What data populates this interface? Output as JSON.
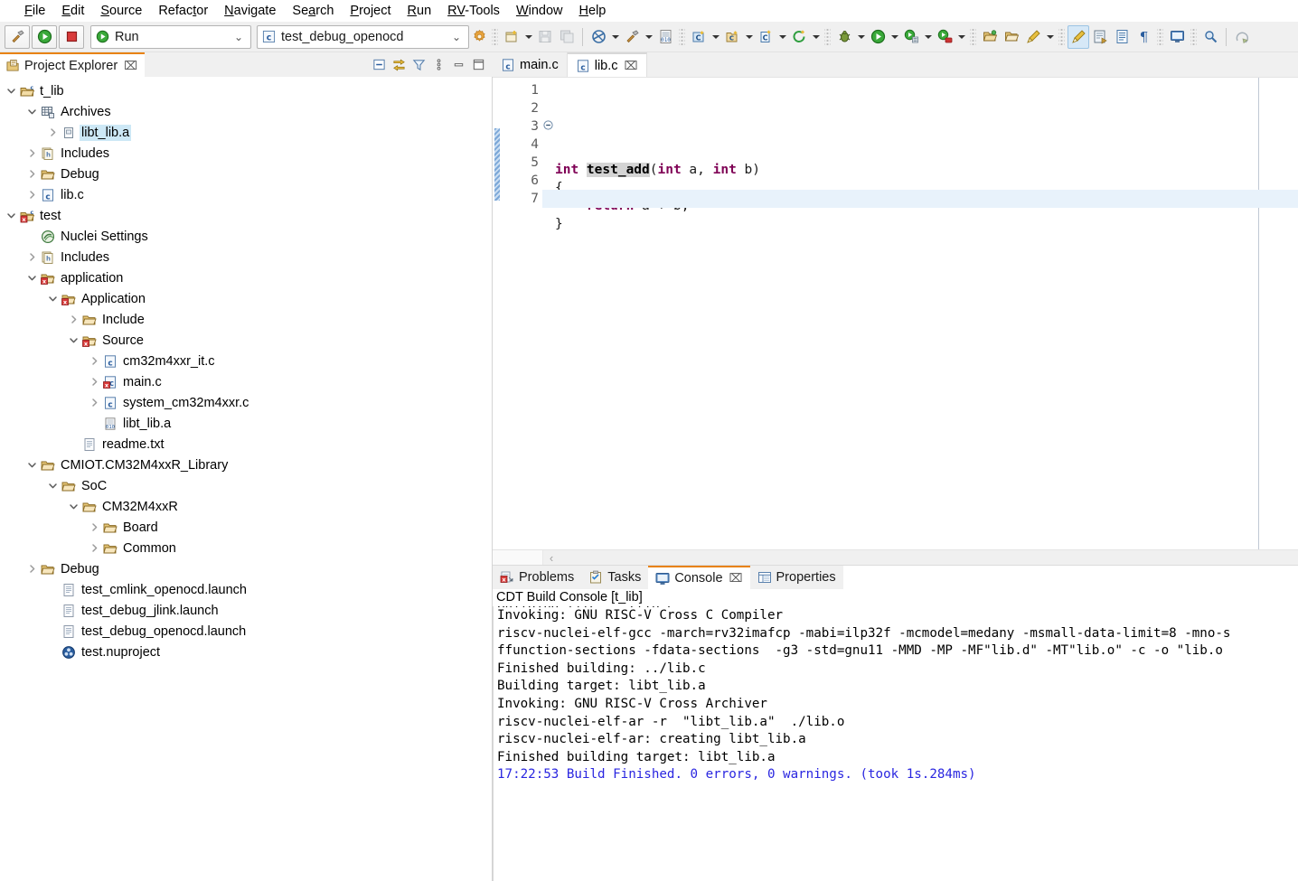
{
  "menubar": {
    "items": [
      {
        "label": "File",
        "mnemonic": "F"
      },
      {
        "label": "Edit",
        "mnemonic": "E"
      },
      {
        "label": "Source",
        "mnemonic": "S"
      },
      {
        "label": "Refactor",
        "mnemonic": "t"
      },
      {
        "label": "Navigate",
        "mnemonic": "N"
      },
      {
        "label": "Search",
        "mnemonic": "a"
      },
      {
        "label": "Project",
        "mnemonic": "P"
      },
      {
        "label": "Run",
        "mnemonic": "R"
      },
      {
        "label": "RV-Tools",
        "mnemonic": "RV"
      },
      {
        "label": "Window",
        "mnemonic": "W"
      },
      {
        "label": "Help",
        "mnemonic": "H"
      }
    ]
  },
  "toolbar": {
    "build_icon": "hammer-icon",
    "run_icon": "run-green-play-icon",
    "stop_icon": "stop-red-square-icon",
    "run_combo": {
      "value": "Run",
      "icon": "run-green-play-icon"
    },
    "config_combo": {
      "value": "test_debug_openocd",
      "icon": "c-file-icon"
    },
    "gear_icon": "gear-icon",
    "right_icons": [
      "new-file-icon",
      "save-icon",
      "save-all-icon",
      "build-all-icon",
      "build-hammer-icon",
      "binary-010-icon",
      "new-c-project-icon",
      "new-c-folder-icon",
      "new-c-file-icon",
      "new-class-icon",
      "debug-bug-icon",
      "run-icon",
      "run-external-tools-icon",
      "run-last-tool-icon",
      "open-folder-icon",
      "open-folder-2-icon",
      "paintbrush-icon",
      "pencil-icon",
      "export-icon",
      "index-icon",
      "pilcrow-icon",
      "console-icon",
      "search-magnifier-icon",
      "skip-icon"
    ]
  },
  "project_explorer": {
    "title": "Project Explorer",
    "close_glyph": "⌧",
    "toolbar_icons": [
      "collapse-all-icon",
      "link-with-editor-icon",
      "filter-icon",
      "view-menu-icon",
      "minimize-icon",
      "maximize-icon"
    ],
    "tree": [
      {
        "label": "t_lib",
        "depth": 0,
        "twist": "open",
        "icon": "c-project-icon",
        "selected": false
      },
      {
        "label": "Archives",
        "depth": 1,
        "twist": "open",
        "icon": "archives-icon",
        "selected": false
      },
      {
        "label": "libt_lib.a",
        "depth": 2,
        "twist": "closed",
        "icon": "archive-file-icon",
        "selected": true
      },
      {
        "label": "Includes",
        "depth": 1,
        "twist": "closed",
        "icon": "includes-icon",
        "selected": false
      },
      {
        "label": "Debug",
        "depth": 1,
        "twist": "closed",
        "icon": "folder-icon",
        "selected": false
      },
      {
        "label": "lib.c",
        "depth": 1,
        "twist": "closed",
        "icon": "c-file-icon",
        "selected": false
      },
      {
        "label": "test",
        "depth": 0,
        "twist": "open",
        "icon": "c-project-error-icon",
        "selected": false
      },
      {
        "label": "Nuclei Settings",
        "depth": 1,
        "twist": "none",
        "icon": "nuclei-settings-icon",
        "selected": false
      },
      {
        "label": "Includes",
        "depth": 1,
        "twist": "closed",
        "icon": "includes-icon",
        "selected": false
      },
      {
        "label": "application",
        "depth": 1,
        "twist": "open",
        "icon": "src-folder-error-icon",
        "selected": false
      },
      {
        "label": "Application",
        "depth": 2,
        "twist": "open",
        "icon": "src-folder-error-icon",
        "selected": false
      },
      {
        "label": "Include",
        "depth": 3,
        "twist": "closed",
        "icon": "folder-icon",
        "selected": false
      },
      {
        "label": "Source",
        "depth": 3,
        "twist": "open",
        "icon": "src-folder-error-icon",
        "selected": false
      },
      {
        "label": "cm32m4xxr_it.c",
        "depth": 4,
        "twist": "closed",
        "icon": "c-file-icon",
        "selected": false
      },
      {
        "label": "main.c",
        "depth": 4,
        "twist": "closed",
        "icon": "c-file-error-icon",
        "selected": false
      },
      {
        "label": "system_cm32m4xxr.c",
        "depth": 4,
        "twist": "closed",
        "icon": "c-file-icon",
        "selected": false
      },
      {
        "label": "libt_lib.a",
        "depth": 4,
        "twist": "none",
        "icon": "binary-file-icon",
        "selected": false
      },
      {
        "label": "readme.txt",
        "depth": 3,
        "twist": "none",
        "icon": "text-file-icon",
        "selected": false
      },
      {
        "label": "CMIOT.CM32M4xxR_Library",
        "depth": 1,
        "twist": "open",
        "icon": "folder-icon",
        "selected": false
      },
      {
        "label": "SoC",
        "depth": 2,
        "twist": "open",
        "icon": "folder-icon",
        "selected": false
      },
      {
        "label": "CM32M4xxR",
        "depth": 3,
        "twist": "open",
        "icon": "folder-icon",
        "selected": false
      },
      {
        "label": "Board",
        "depth": 4,
        "twist": "closed",
        "icon": "folder-icon",
        "selected": false
      },
      {
        "label": "Common",
        "depth": 4,
        "twist": "closed",
        "icon": "folder-icon",
        "selected": false
      },
      {
        "label": "Debug",
        "depth": 1,
        "twist": "closed",
        "icon": "folder-icon",
        "selected": false
      },
      {
        "label": "test_cmlink_openocd.launch",
        "depth": 2,
        "twist": "none",
        "icon": "launch-file-icon",
        "selected": false
      },
      {
        "label": "test_debug_jlink.launch",
        "depth": 2,
        "twist": "none",
        "icon": "launch-file-icon",
        "selected": false
      },
      {
        "label": "test_debug_openocd.launch",
        "depth": 2,
        "twist": "none",
        "icon": "launch-file-icon",
        "selected": false
      },
      {
        "label": "test.nuproject",
        "depth": 2,
        "twist": "none",
        "icon": "nuproject-icon",
        "selected": false
      }
    ]
  },
  "editor": {
    "tabs": [
      {
        "label": "main.c",
        "icon": "c-file-icon",
        "active": false,
        "closable": false
      },
      {
        "label": "lib.c",
        "icon": "c-file-icon",
        "active": true,
        "closable": true,
        "close_glyph": "⌧"
      }
    ],
    "line_numbers": [
      "1",
      "2",
      "3",
      "4",
      "5",
      "6",
      "7"
    ],
    "fold_marker_line": 3,
    "current_line": 7,
    "code_lines": [
      {
        "n": 1,
        "segments": [
          {
            "t": "",
            "c": "plain"
          }
        ]
      },
      {
        "n": 2,
        "segments": [
          {
            "t": "",
            "c": "plain"
          }
        ]
      },
      {
        "n": 3,
        "segments": [
          {
            "t": "int ",
            "c": "keyword"
          },
          {
            "t": "test_add",
            "c": "funcname"
          },
          {
            "t": "(",
            "c": "plain"
          },
          {
            "t": "int",
            "c": "keyword"
          },
          {
            "t": " a, ",
            "c": "plain"
          },
          {
            "t": "int",
            "c": "keyword"
          },
          {
            "t": " b)",
            "c": "plain"
          }
        ]
      },
      {
        "n": 4,
        "segments": [
          {
            "t": "{",
            "c": "plain"
          }
        ]
      },
      {
        "n": 5,
        "segments": [
          {
            "t": "    ",
            "c": "plain"
          },
          {
            "t": "return",
            "c": "keyword"
          },
          {
            "t": " a + b;",
            "c": "plain"
          }
        ]
      },
      {
        "n": 6,
        "segments": [
          {
            "t": "}",
            "c": "plain"
          }
        ]
      },
      {
        "n": 7,
        "segments": [
          {
            "t": "",
            "c": "plain"
          }
        ]
      }
    ],
    "scroll_left_arrow": "‹"
  },
  "bottom_panel": {
    "tabs": [
      {
        "label": "Problems",
        "icon": "problems-icon",
        "active": false,
        "closable": false
      },
      {
        "label": "Tasks",
        "icon": "tasks-icon",
        "active": false,
        "closable": false
      },
      {
        "label": "Console",
        "icon": "console-icon",
        "active": true,
        "closable": true,
        "close_glyph": "⌧"
      },
      {
        "label": "Properties",
        "icon": "properties-icon",
        "active": false,
        "closable": false
      }
    ],
    "console_title": "CDT Build Console [t_lib]",
    "console_lines": [
      {
        "text": "Building file: ../lib.c",
        "color": "black",
        "clipped_top": true
      },
      {
        "text": "Invoking: GNU RISC-V Cross C Compiler",
        "color": "black"
      },
      {
        "text": "riscv-nuclei-elf-gcc -march=rv32imafcp -mabi=ilp32f -mcmodel=medany -msmall-data-limit=8 -mno-s",
        "color": "black"
      },
      {
        "text": "ffunction-sections -fdata-sections  -g3 -std=gnu11 -MMD -MP -MF\"lib.d\" -MT\"lib.o\" -c -o \"lib.o",
        "color": "black"
      },
      {
        "text": "Finished building: ../lib.c",
        "color": "black"
      },
      {
        "text": "",
        "color": "black"
      },
      {
        "text": "Building target: libt_lib.a",
        "color": "black"
      },
      {
        "text": "Invoking: GNU RISC-V Cross Archiver",
        "color": "black"
      },
      {
        "text": "riscv-nuclei-elf-ar -r  \"libt_lib.a\"  ./lib.o",
        "color": "black"
      },
      {
        "text": "riscv-nuclei-elf-ar: creating libt_lib.a",
        "color": "black"
      },
      {
        "text": "Finished building target: libt_lib.a",
        "color": "black"
      },
      {
        "text": "",
        "color": "black"
      },
      {
        "text": "",
        "color": "black"
      },
      {
        "text": "17:22:53 Build Finished. 0 errors, 0 warnings. (took 1s.284ms)",
        "color": "blue"
      }
    ]
  },
  "colors": {
    "tab_accent": "#e8820c",
    "selection": "#cde8f6",
    "current_line": "#e8f2fb",
    "keyword": "#7f0055",
    "console_blue": "#2a26e0",
    "toolbar_bg": "#f0f0f0"
  }
}
